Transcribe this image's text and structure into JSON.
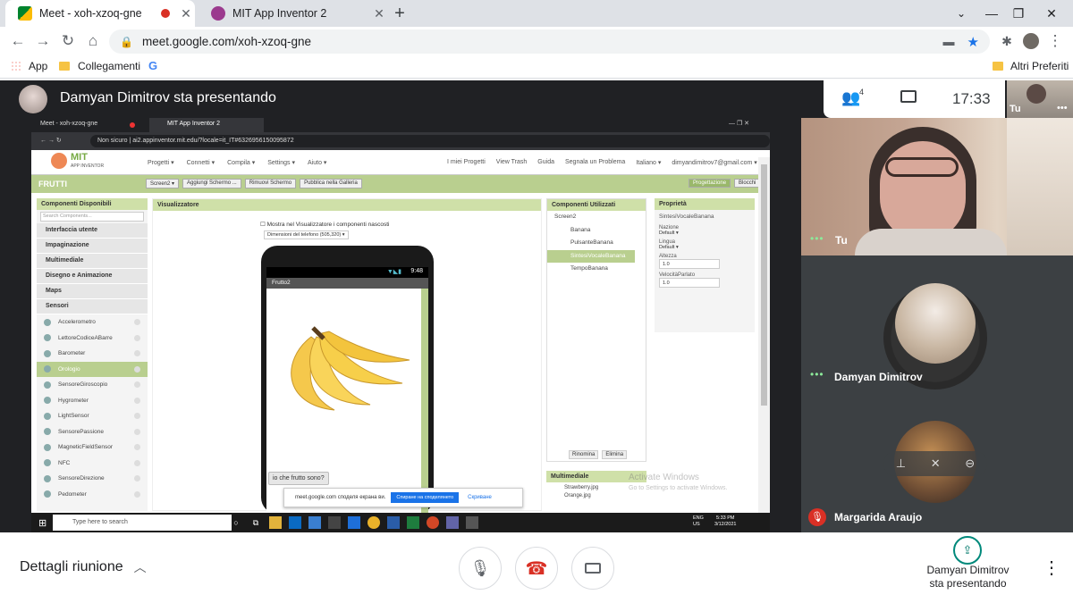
{
  "browser": {
    "tabs": [
      {
        "label": "Meet - xoh-xzoq-gne",
        "active": true
      },
      {
        "label": "MIT App Inventor 2",
        "active": false
      }
    ],
    "url": "meet.google.com/xoh-xzoq-gne",
    "bookmarks": {
      "apps": "App",
      "folder": "Collegamenti",
      "google": "G",
      "other": "Altri Preferiti"
    }
  },
  "meet": {
    "presenter_banner": "Damyan Dimitrov sta presentando",
    "participant_count": "4",
    "clock": "17:33",
    "self_thumb_label": "Tu",
    "tiles": [
      {
        "name": "Tu"
      },
      {
        "name": "Damyan Dimitrov"
      },
      {
        "name": "Margarida Araujo",
        "muted": true
      }
    ],
    "bottom": {
      "details": "Dettagli riunione",
      "presenting_line1": "Damyan Dimitrov",
      "presenting_line2": "sta presentando"
    }
  },
  "shared_screen": {
    "tabs": [
      "Meet - xoh-xzoq-gne",
      "MIT App Inventor 2"
    ],
    "security": "Non sicuro",
    "url": "ai2.appinventor.mit.edu/?locale=it_IT#6326956150095872",
    "logo_line1": "MIT",
    "logo_line2": "APP INVENTOR",
    "menu": [
      "Progetti ▾",
      "Connetti ▾",
      "Compila ▾",
      "Settings ▾",
      "Aiuto ▾"
    ],
    "top_links": [
      "I miei Progetti",
      "View Trash",
      "Guida",
      "Segnala un Problema",
      "Italiano ▾",
      "dimyandimitrov7@gmail.com ▾"
    ],
    "project": "FRUTTI",
    "project_buttons": [
      "Screen2 ▾",
      "Aggiungi Schermo ...",
      "Rimuovi Schermo",
      "Pubblica nella Galleria"
    ],
    "view_buttons": [
      "Progettazione",
      "Blocchi"
    ],
    "palette": {
      "header": "Componenti Disponibili",
      "search_placeholder": "Search Components...",
      "categories": [
        "Interfaccia utente",
        "Impaginazione",
        "Multimediale",
        "Disegno e Animazione",
        "Maps",
        "Sensori"
      ],
      "items": [
        "Accelerometro",
        "LettoreCodiceABarre",
        "Barometer",
        "Orologio",
        "SensoreGiroscopio",
        "Hygrometer",
        "LightSensor",
        "SensorePassione",
        "MagneticFieldSensor",
        "NFC",
        "SensoreDirezione",
        "Pedometer"
      ]
    },
    "viewer": {
      "header": "Visualizzatore",
      "checkbox": "Mostra nel Visualizzatore i componenti nascosti",
      "size": "Dimensioni del telefono (505,320) ▾",
      "phone_time": "9:48",
      "screen_title": "Frutto2",
      "button": "io che frutto sono?"
    },
    "tree": {
      "header": "Componenti Utilizzati",
      "items": [
        "Screen2",
        "Banana",
        "PulsanteBanana",
        "SintesiVocaleBanana",
        "TempoBanana"
      ],
      "rename": "Rinomina",
      "delete": "Elimina"
    },
    "media": {
      "header": "Multimediale",
      "files": [
        "Strawberry.jpg",
        "Orange.jpg"
      ]
    },
    "props": {
      "header": "Proprietà",
      "component": "SintesiVocaleBanana",
      "fields": [
        {
          "label": "Nazione",
          "value": "Default ▾"
        },
        {
          "label": "Lingua",
          "value": "Default ▾"
        },
        {
          "label": "Altezza",
          "value": "1.0"
        },
        {
          "label": "VelocitàParlato",
          "value": "1.0"
        }
      ]
    },
    "share_notice": {
      "text": "meet.google.com споделя екрана ви.",
      "stop": "Спиране на споделянето",
      "hide": "Скриване"
    },
    "watermark_line1": "Activate Windows",
    "watermark_line2": "Go to Settings to activate Windows.",
    "taskbar": {
      "search": "Type here to search",
      "lang1": "ENG",
      "lang2": "US",
      "time": "5:33 PM",
      "date": "3/12/2021"
    }
  }
}
